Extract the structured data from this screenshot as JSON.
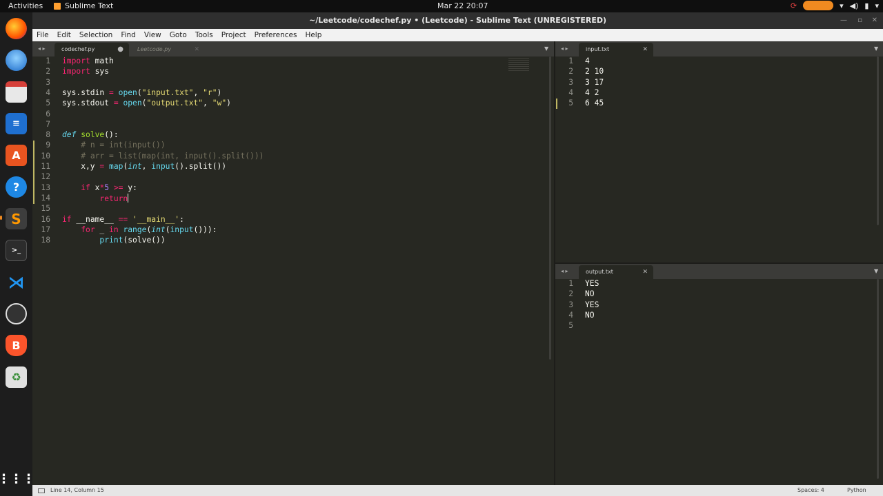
{
  "topbar": {
    "activities": "Activities",
    "app_name": "Sublime Text",
    "clock": "Mar 22  20:07"
  },
  "window": {
    "title": "~/Leetcode/codechef.py • (Leetcode) - Sublime Text (UNREGISTERED)"
  },
  "menu": [
    "File",
    "Edit",
    "Selection",
    "Find",
    "View",
    "Goto",
    "Tools",
    "Project",
    "Preferences",
    "Help"
  ],
  "left_pane": {
    "tabs": [
      {
        "label": "codechef.py",
        "active": true,
        "modified": true
      },
      {
        "label": "Leetcode.py",
        "active": false
      }
    ],
    "line_numbers": [
      "1",
      "2",
      "3",
      "4",
      "5",
      "6",
      "7",
      "8",
      "9",
      "10",
      "11",
      "12",
      "13",
      "14",
      "15",
      "16",
      "17",
      "18"
    ]
  },
  "input_pane": {
    "tab": "input.txt",
    "line_numbers": [
      "1",
      "2",
      "3",
      "4",
      "5"
    ],
    "lines": [
      "4",
      "2 10",
      "3 17",
      "4 2",
      "6 45"
    ]
  },
  "output_pane": {
    "tab": "output.txt",
    "line_numbers": [
      "1",
      "2",
      "3",
      "4",
      "5"
    ],
    "lines": [
      "YES",
      "NO",
      "YES",
      "NO",
      ""
    ]
  },
  "status": {
    "position": "Line 14, Column 15",
    "spaces": "Spaces: 4",
    "syntax": "Python"
  },
  "icons": [
    "firefox-icon",
    "thunderbird-icon",
    "files-icon",
    "writer-icon",
    "software-icon",
    "help-icon",
    "sublime-icon",
    "terminal-icon",
    "vscode-icon",
    "obs-icon",
    "brave-icon",
    "trash-icon",
    "apps-grid-icon"
  ]
}
